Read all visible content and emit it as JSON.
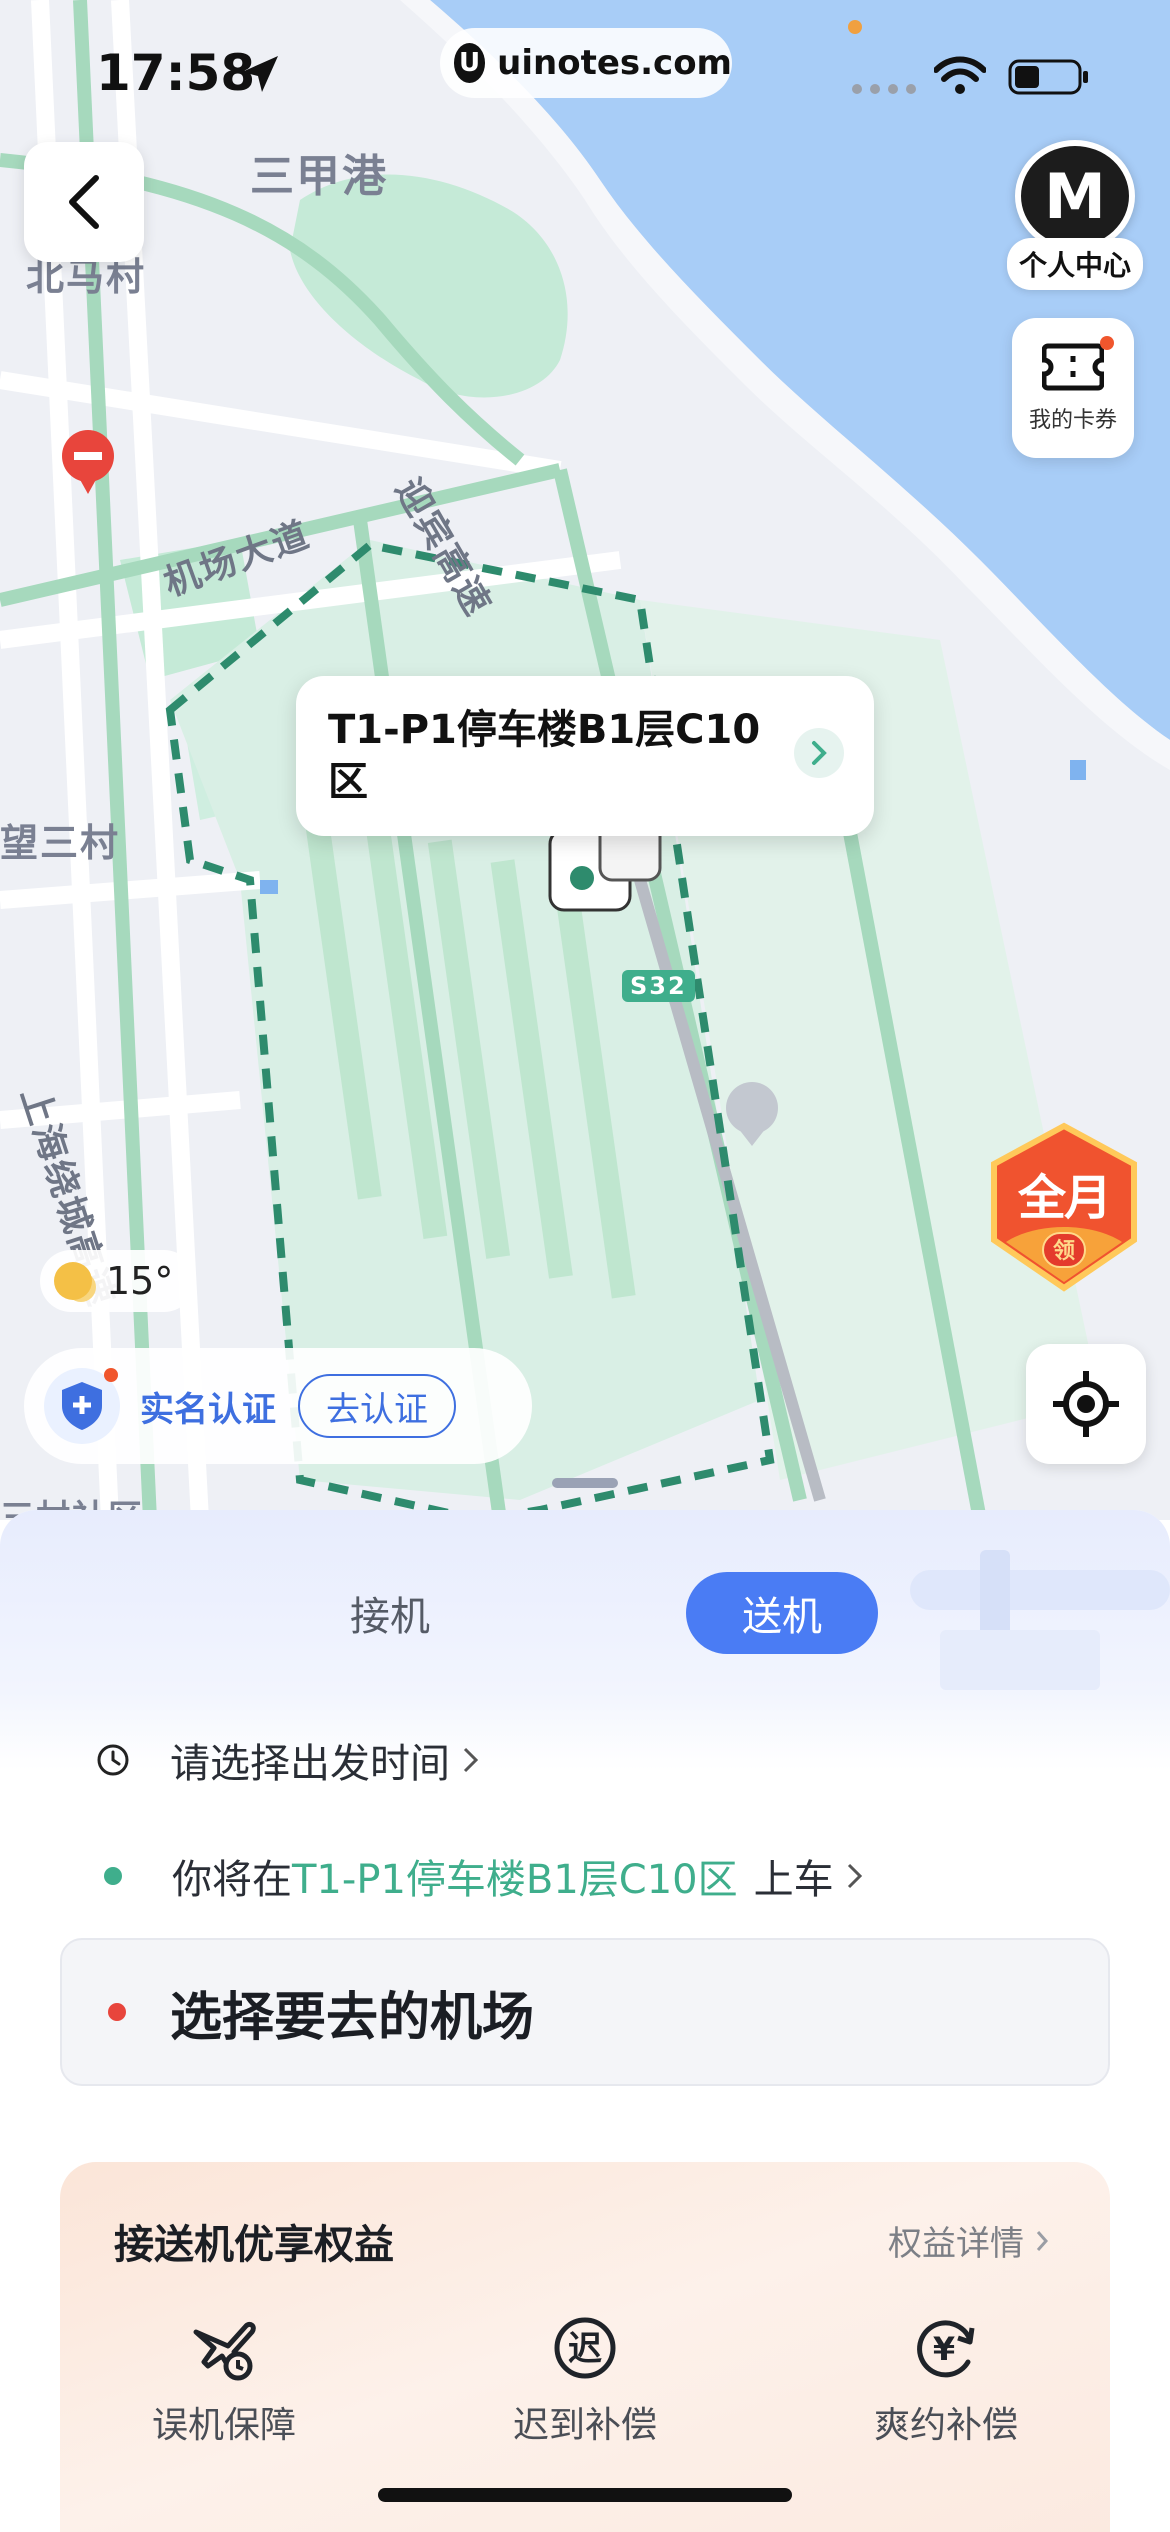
{
  "status_bar": {
    "time": "17:58",
    "url": "uinotes.com"
  },
  "map": {
    "labels": [
      "三甲港",
      "北马村",
      "机场大道",
      "迎宾高速",
      "望三村",
      "上海绕城高速",
      "S32",
      "三村社区"
    ],
    "pickup_point": "T1-P1停车楼B1层C10区",
    "weather": "15°",
    "verify": {
      "label": "实名认证",
      "button": "去认证"
    },
    "promo_badge": {
      "text": "全月",
      "sub": "领"
    }
  },
  "right_panel": {
    "personal_center": "个人中心",
    "my_coupons": "我的卡券"
  },
  "tabs": {
    "pickup": "接机",
    "dropoff": "送机",
    "active": "dropoff"
  },
  "trip": {
    "departure_time": "请选择出发时间",
    "board_prefix": "你将在",
    "board_location": "T1-P1停车楼B1层C10区",
    "board_suffix": "上车",
    "destination_placeholder": "选择要去的机场"
  },
  "benefits": {
    "title": "接送机优享权益",
    "details_link": "权益详情",
    "items": [
      {
        "label": "误机保障",
        "icon": "flight-delay-icon"
      },
      {
        "label": "迟到补偿",
        "icon": "late-compensation-icon"
      },
      {
        "label": "爽约补偿",
        "icon": "no-show-compensation-icon"
      }
    ]
  },
  "colors": {
    "primary_blue": "#4a7cf4",
    "green": "#3fae8c",
    "red_dot": "#e8453c",
    "water": "#a8cdf7",
    "park_green": "#c5ead7"
  }
}
